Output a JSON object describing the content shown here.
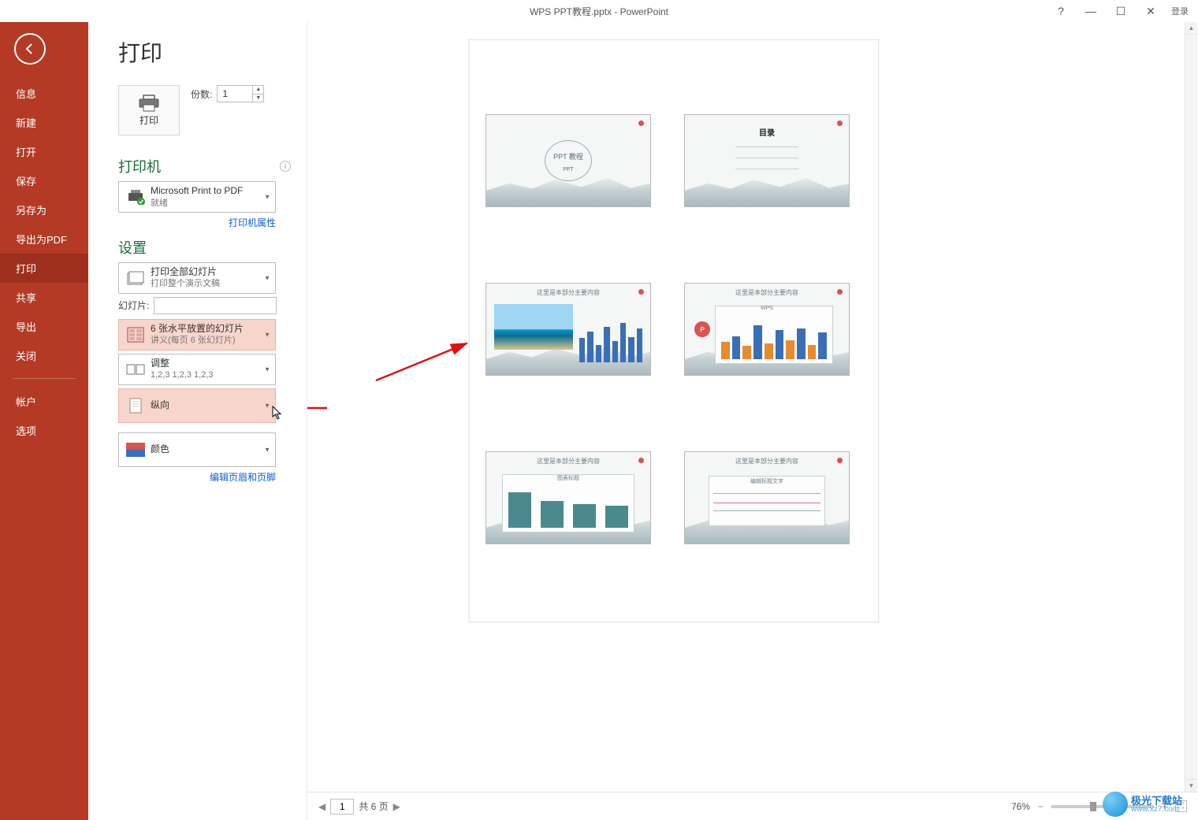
{
  "titlebar": {
    "title": "WPS PPT教程.pptx - PowerPoint",
    "login": "登录"
  },
  "sidebar": {
    "items": [
      "信息",
      "新建",
      "打开",
      "保存",
      "另存为",
      "导出为PDF",
      "打印",
      "共享",
      "导出",
      "关闭"
    ],
    "lower": [
      "帐户",
      "选项"
    ]
  },
  "page_title": "打印",
  "print_button_label": "打印",
  "copies": {
    "label": "份数:",
    "value": "1"
  },
  "printer_section": {
    "heading": "打印机",
    "name": "Microsoft Print to PDF",
    "status": "就绪",
    "properties_link": "打印机属性"
  },
  "settings": {
    "heading": "设置",
    "all_slides": {
      "title": "打印全部幻灯片",
      "sub": "打印整个演示文稿"
    },
    "slides_label": "幻灯片:",
    "slides_value": "",
    "layout": {
      "title": "6 张水平放置的幻灯片",
      "sub": "讲义(每页 6 张幻灯片)"
    },
    "collate": {
      "title": "调整",
      "sub": "1,2,3    1,2,3    1,2,3"
    },
    "orientation": {
      "title": "纵向"
    },
    "color": {
      "title": "颜色"
    },
    "edit_hf_link": "编辑页眉和页脚"
  },
  "preview_slides": {
    "s1_title": "PPT 教程",
    "s1_sub": "PPT",
    "s2_title": "目录",
    "s3_top": "这里是本部分主要内容",
    "s4_top": "这里是本部分主要内容",
    "s5_top": "这里是本部分主要内容",
    "s6_top": "这里是本部分主要内容",
    "s4_chart": "WPS",
    "s5_chart": "图表标题",
    "s6_chart": "编辑标题文字"
  },
  "footer": {
    "page_value": "1",
    "total_text": "共 6 页",
    "zoom": "76%",
    "site_cn": "极光下载站",
    "site_url": "www.xz7.com"
  }
}
